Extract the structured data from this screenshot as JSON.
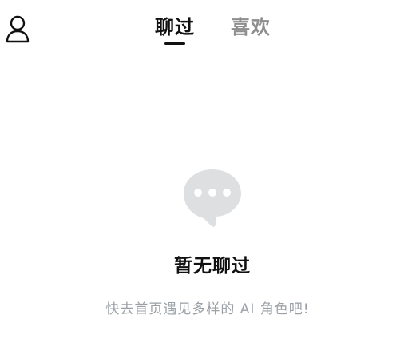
{
  "header": {
    "profile_icon": "user-icon",
    "tabs": [
      {
        "label": "聊过",
        "active": true
      },
      {
        "label": "喜欢",
        "active": false
      }
    ]
  },
  "empty_state": {
    "icon": "chat-bubble-icon",
    "title": "暂无聊过",
    "subtitle": "快去首页遇见多样的 AI 角色吧!"
  },
  "colors": {
    "text_primary": "#111111",
    "text_inactive": "#8e8e8e",
    "text_muted": "#9aa0a6",
    "icon_gray": "#dedfe1"
  }
}
